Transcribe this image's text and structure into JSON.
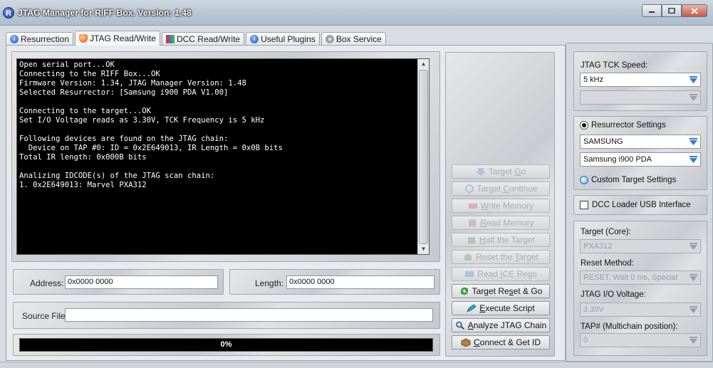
{
  "window": {
    "title": "JTAG Manager for RIFF Box. Version: 1.48",
    "logo_letter": "R"
  },
  "tabs": [
    {
      "label": "Resurrection",
      "icon": "info-icon"
    },
    {
      "label": "JTAG Read/Write",
      "icon": "shield-icon"
    },
    {
      "label": "DCC Read/Write",
      "icon": "books-icon"
    },
    {
      "label": "Useful Plugins",
      "icon": "info-icon"
    },
    {
      "label": "Box Service",
      "icon": "gear-icon"
    }
  ],
  "console": {
    "text": "Open serial port...OK\nConnecting to the RIFF Box...OK\nFirmware Version: 1.34, JTAG Manager Version: 1.48\nSelected Resurrector: [Samsung i900 PDA V1.00]\n\nConnecting to the target...OK\nSet I/O Voltage reads as 3.30V, TCK Frequency is 5 kHz\n\nFollowing devices are found on the JTAG chain:\n  Device on TAP #0: ID = 0x2E649013, IR Length = 0x0B bits\nTotal IR length: 0x000B bits\n\nAnalizing IDCODE(s) of the JTAG scan chain:\n1. 0x2E649013: Marvel PXA312"
  },
  "fields": {
    "address_label": "Address:",
    "address_value": "0x0000 0000",
    "length_label": "Length:",
    "length_value": "0x0000 0000",
    "source_file_label": "Source File:",
    "source_file_value": ""
  },
  "progress": {
    "value": 0,
    "label": "0%"
  },
  "actions": {
    "target_go": {
      "pre": "Target ",
      "key": "G",
      "post": "o"
    },
    "target_continue": {
      "pre": "Target ",
      "key": "C",
      "post": "ontinue"
    },
    "write_memory": {
      "pre": "",
      "key": "W",
      "post": "rite Memory"
    },
    "read_memory": {
      "pre": "",
      "key": "R",
      "post": "ead Memory"
    },
    "halt_target": {
      "pre": "",
      "key": "H",
      "post": "alt the Target"
    },
    "reset_target": {
      "pre": "Reset the ",
      "key": "T",
      "post": "arget"
    },
    "read_ice_regs": {
      "pre": "Read ",
      "key": "I",
      "post": "CE Regs"
    },
    "target_reset_go": {
      "pre": "Target Re",
      "key": "s",
      "post": "et & Go"
    },
    "execute_script": {
      "pre": "",
      "key": "E",
      "post": "xecute Script"
    },
    "analyze_chain": {
      "pre": "",
      "key": "A",
      "post": "nalyze JTAG Chain"
    },
    "connect": {
      "pre": "",
      "key": "C",
      "post": "onnect & Get ID"
    }
  },
  "settings": {
    "tck_speed_label": "JTAG TCK Speed:",
    "tck_speed_value": "5 kHz",
    "tck_secondary_value": "",
    "resurrector_label": "Resurrector Settings",
    "manufacturer_value": "SAMSUNG",
    "model_value": "Samsung i900 PDA",
    "custom_target_label": "Custom Target Settings",
    "dcc_usb_label": "DCC Loader USB Interface",
    "core_label": "Target (Core):",
    "core_value": "PXA312",
    "reset_method_label": "Reset Method:",
    "reset_method_value": "RESET, Wait 0 ms, Special",
    "io_voltage_label": "JTAG I/O Voltage:",
    "io_voltage_value": "3.30V",
    "tap_label": "TAP# (Multichain position):",
    "tap_value": "0"
  },
  "colors": {
    "console_bg": "#000000",
    "console_fg": "#ffffff",
    "accent_blue": "#3b8ae6"
  }
}
